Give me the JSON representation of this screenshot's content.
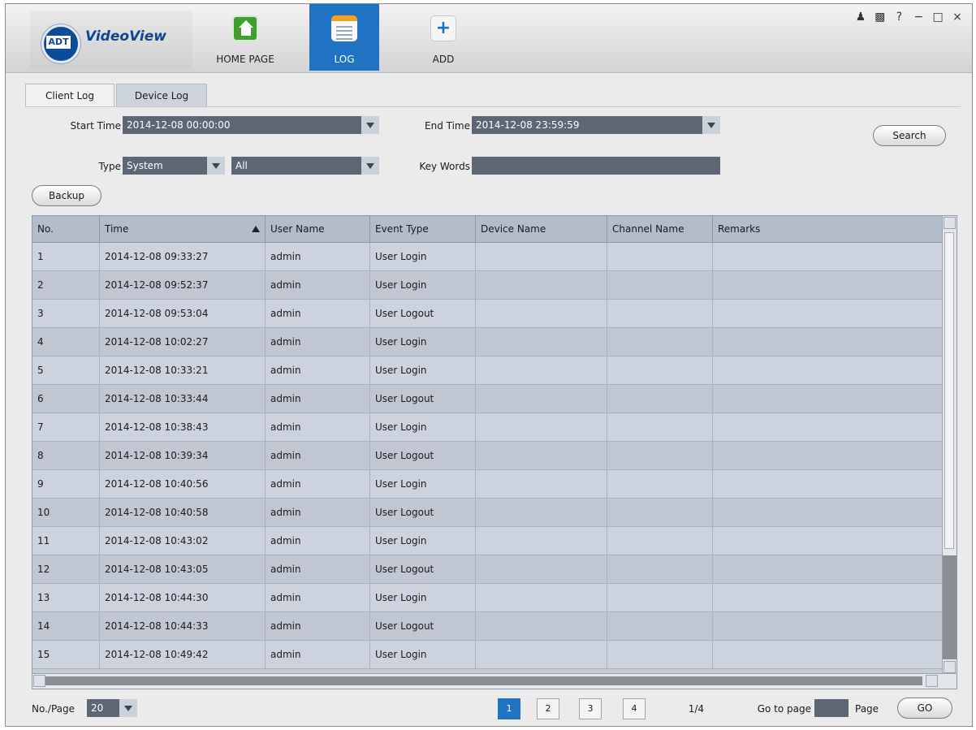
{
  "app": {
    "logo_badge": "ADT",
    "logo_text": "VideoView",
    "accent_color": "#1f73c2"
  },
  "nav": [
    {
      "label": "HOME PAGE",
      "icon": "home-icon"
    },
    {
      "label": "LOG",
      "icon": "log-icon",
      "active": true
    },
    {
      "label": "ADD",
      "icon": "add-icon"
    }
  ],
  "window_controls": {
    "user": "user-icon",
    "lock": "lock-icon",
    "help": "?",
    "minimize": "−",
    "maximize": "□",
    "close": "×"
  },
  "tabs": {
    "client_log": "Client Log",
    "device_log": "Device Log",
    "active": "Client Log"
  },
  "filters": {
    "start_time_label": "Start Time",
    "start_time_value": "2014-12-08 00:00:00",
    "end_time_label": "End Time",
    "end_time_value": "2014-12-08 23:59:59",
    "type_label": "Type",
    "type_value": "System",
    "subtype_value": "All",
    "keywords_label": "Key Words",
    "keywords_value": "",
    "search_button": "Search",
    "backup_button": "Backup"
  },
  "table": {
    "columns": [
      "No.",
      "Time",
      "User Name",
      "Event Type",
      "Device Name",
      "Channel Name",
      "Remarks"
    ],
    "sort_column": "Time",
    "rows": [
      {
        "no": "1",
        "time": "2014-12-08 09:33:27",
        "user": "admin",
        "event": "User Login",
        "device": "",
        "channel": "",
        "remarks": ""
      },
      {
        "no": "2",
        "time": "2014-12-08 09:52:37",
        "user": "admin",
        "event": "User Login",
        "device": "",
        "channel": "",
        "remarks": ""
      },
      {
        "no": "3",
        "time": "2014-12-08 09:53:04",
        "user": "admin",
        "event": "User Logout",
        "device": "",
        "channel": "",
        "remarks": ""
      },
      {
        "no": "4",
        "time": "2014-12-08 10:02:27",
        "user": "admin",
        "event": "User Login",
        "device": "",
        "channel": "",
        "remarks": ""
      },
      {
        "no": "5",
        "time": "2014-12-08 10:33:21",
        "user": "admin",
        "event": "User Login",
        "device": "",
        "channel": "",
        "remarks": ""
      },
      {
        "no": "6",
        "time": "2014-12-08 10:33:44",
        "user": "admin",
        "event": "User Logout",
        "device": "",
        "channel": "",
        "remarks": ""
      },
      {
        "no": "7",
        "time": "2014-12-08 10:38:43",
        "user": "admin",
        "event": "User Login",
        "device": "",
        "channel": "",
        "remarks": ""
      },
      {
        "no": "8",
        "time": "2014-12-08 10:39:34",
        "user": "admin",
        "event": "User Logout",
        "device": "",
        "channel": "",
        "remarks": ""
      },
      {
        "no": "9",
        "time": "2014-12-08 10:40:56",
        "user": "admin",
        "event": "User Login",
        "device": "",
        "channel": "",
        "remarks": ""
      },
      {
        "no": "10",
        "time": "2014-12-08 10:40:58",
        "user": "admin",
        "event": "User Logout",
        "device": "",
        "channel": "",
        "remarks": ""
      },
      {
        "no": "11",
        "time": "2014-12-08 10:43:02",
        "user": "admin",
        "event": "User Login",
        "device": "",
        "channel": "",
        "remarks": ""
      },
      {
        "no": "12",
        "time": "2014-12-08 10:43:05",
        "user": "admin",
        "event": "User Logout",
        "device": "",
        "channel": "",
        "remarks": ""
      },
      {
        "no": "13",
        "time": "2014-12-08 10:44:30",
        "user": "admin",
        "event": "User Login",
        "device": "",
        "channel": "",
        "remarks": ""
      },
      {
        "no": "14",
        "time": "2014-12-08 10:44:33",
        "user": "admin",
        "event": "User Logout",
        "device": "",
        "channel": "",
        "remarks": ""
      },
      {
        "no": "15",
        "time": "2014-12-08 10:49:42",
        "user": "admin",
        "event": "User Login",
        "device": "",
        "channel": "",
        "remarks": ""
      }
    ]
  },
  "footer": {
    "per_page_label": "No./Page",
    "per_page_value": "20",
    "pages": [
      "1",
      "2",
      "3",
      "4"
    ],
    "current_page": "1",
    "page_indicator": "1/4",
    "goto_label": "Go to page",
    "goto_value": "",
    "page_label": "Page",
    "go_button": "GO"
  }
}
